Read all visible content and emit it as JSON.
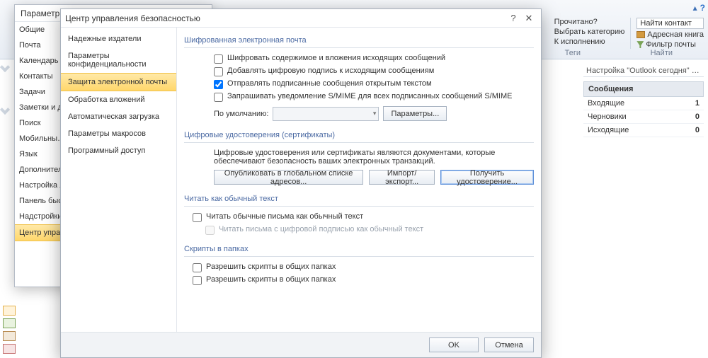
{
  "ribbon": {
    "read_label": "Прочитано?",
    "category_label": "Выбрать категорию",
    "follow_label": "К исполнению",
    "tags_group": "Теги",
    "find_contact": "Найти контакт",
    "address_book": "Адресная книга",
    "filter_mail": "Фильтр почты",
    "find_group": "Найти"
  },
  "options": {
    "title": "Параметры О…",
    "nav": [
      "Общие",
      "Почта",
      "Календарь",
      "Контакты",
      "Задачи",
      "Заметки и д…",
      "Поиск",
      "Мобильны…",
      "Язык",
      "Дополнител…",
      "Настройка л…",
      "Панель быст…",
      "Надстройки",
      "Центр управ…"
    ],
    "selected_index": 13
  },
  "tc": {
    "title": "Центр управления безопасностью",
    "nav": [
      "Надежные издатели",
      "Параметры конфиденциальности",
      "Защита электронной почты",
      "Обработка вложений",
      "Автоматическая загрузка",
      "Параметры макросов",
      "Программный доступ"
    ],
    "selected_index": 2,
    "s1": {
      "title": "Шифрованная электронная почта",
      "cb1": "Шифровать содержимое и вложения исходящих сообщений",
      "cb2": "Добавлять цифровую подпись к исходящим сообщениям",
      "cb3": "Отправлять подписанные сообщения открытым текстом",
      "cb4": "Запрашивать уведомление S/MIME для всех подписанных сообщений S/MIME",
      "default_label": "По умолчанию:",
      "params_btn": "Параметры..."
    },
    "s2": {
      "title": "Цифровые удостоверения (сертификаты)",
      "desc": "Цифровые удостоверения или сертификаты являются документами, которые обеспечивают безопасность ваших электронных транзакций.",
      "btn1": "Опубликовать в глобальном списке адресов...",
      "btn2": "Импорт/экспорт...",
      "btn3": "Получить удостоверение..."
    },
    "s3": {
      "title": "Читать как обычный текст",
      "cb1": "Читать обычные письма как обычный текст",
      "cb2": "Читать письма с цифровой подписью как обычный текст"
    },
    "s4": {
      "title": "Скрипты в папках",
      "cb1": "Разрешить скрипты в общих папках",
      "cb2": "Разрешить скрипты в общих папках"
    },
    "ok": "OK",
    "cancel": "Отмена"
  },
  "ot": {
    "title": "Настройка \"Outlook сегодня\" …",
    "header": "Сообщения",
    "rows": [
      {
        "label": "Входящие",
        "value": "1"
      },
      {
        "label": "Черновики",
        "value": "0"
      },
      {
        "label": "Исходящие",
        "value": "0"
      }
    ]
  }
}
